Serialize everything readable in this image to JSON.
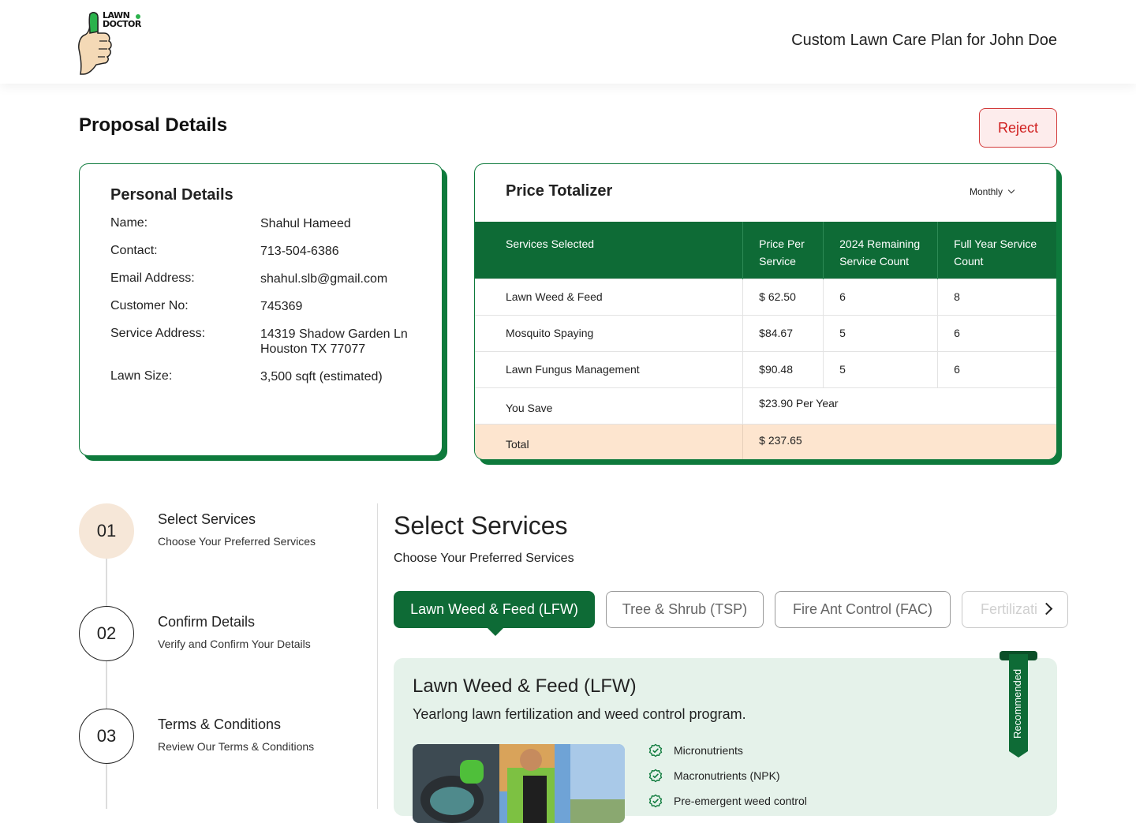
{
  "header": {
    "logo_text_line1": "LAWN",
    "logo_text_line2": "DOCTOR",
    "title": "Custom Lawn Care Plan for John Doe"
  },
  "page": {
    "title": "Proposal Details",
    "reject_label": "Reject"
  },
  "personal_details": {
    "title": "Personal Details",
    "rows": [
      {
        "label": "Name:",
        "value": "Shahul Hameed"
      },
      {
        "label": "Contact:",
        "value": "713-504-6386"
      },
      {
        "label": "Email Address:",
        "value": "shahul.slb@gmail.com"
      },
      {
        "label": "Customer No:",
        "value": "745369"
      },
      {
        "label": "Service Address:",
        "value": "14319 Shadow Garden Ln",
        "value2": "Houston TX 77077"
      },
      {
        "label": "Lawn Size:",
        "value": "3,500 sqft (estimated)"
      }
    ]
  },
  "price_totalizer": {
    "title": "Price Totalizer",
    "period": "Monthly",
    "columns": [
      "Services Selected",
      "Price Per Service",
      "2024 Remaining Service Count",
      "Full Year Service Count"
    ],
    "rows": [
      {
        "service": "Lawn Weed & Feed",
        "price": "$ 62.50",
        "remaining": "6",
        "full_year": "8"
      },
      {
        "service": "Mosquito Spaying",
        "price": "$84.67",
        "remaining": "5",
        "full_year": "6"
      },
      {
        "service": "Lawn Fungus Management",
        "price": "$90.48",
        "remaining": "5",
        "full_year": "6"
      }
    ],
    "you_save_label": "You Save",
    "you_save_value": "$23.90 Per Year",
    "total_label": "Total",
    "total_value": "$ 237.65"
  },
  "steps": [
    {
      "number": "01",
      "title": "Select Services",
      "subtitle": "Choose Your Preferred Services",
      "active": true
    },
    {
      "number": "02",
      "title": "Confirm Details",
      "subtitle": "Verify and Confirm Your Details",
      "active": false
    },
    {
      "number": "03",
      "title": "Terms & Conditions",
      "subtitle": "Review Our Terms & Conditions",
      "active": false
    }
  ],
  "select_services": {
    "title": "Select Services",
    "subtitle": "Choose Your Preferred Services",
    "tabs": [
      "Lawn Weed & Feed (LFW)",
      "Tree & Shrub (TSP)",
      "Fire Ant Control (FAC)",
      "Fertilizati"
    ],
    "active_tab": 0
  },
  "service_card": {
    "title": "Lawn Weed & Feed (LFW)",
    "description": "Yearlong lawn fertilization and weed control program.",
    "badge": "Recommended",
    "features": [
      "Micronutrients",
      "Macronutrients (NPK)",
      "Pre-emergent weed control"
    ]
  },
  "colors": {
    "brand_green": "#0e6b36",
    "reject_red": "#d01f1f",
    "total_row_bg": "#fde5cf",
    "step_active_bg": "#f6e7d8",
    "service_card_bg": "#e5f2ea"
  }
}
